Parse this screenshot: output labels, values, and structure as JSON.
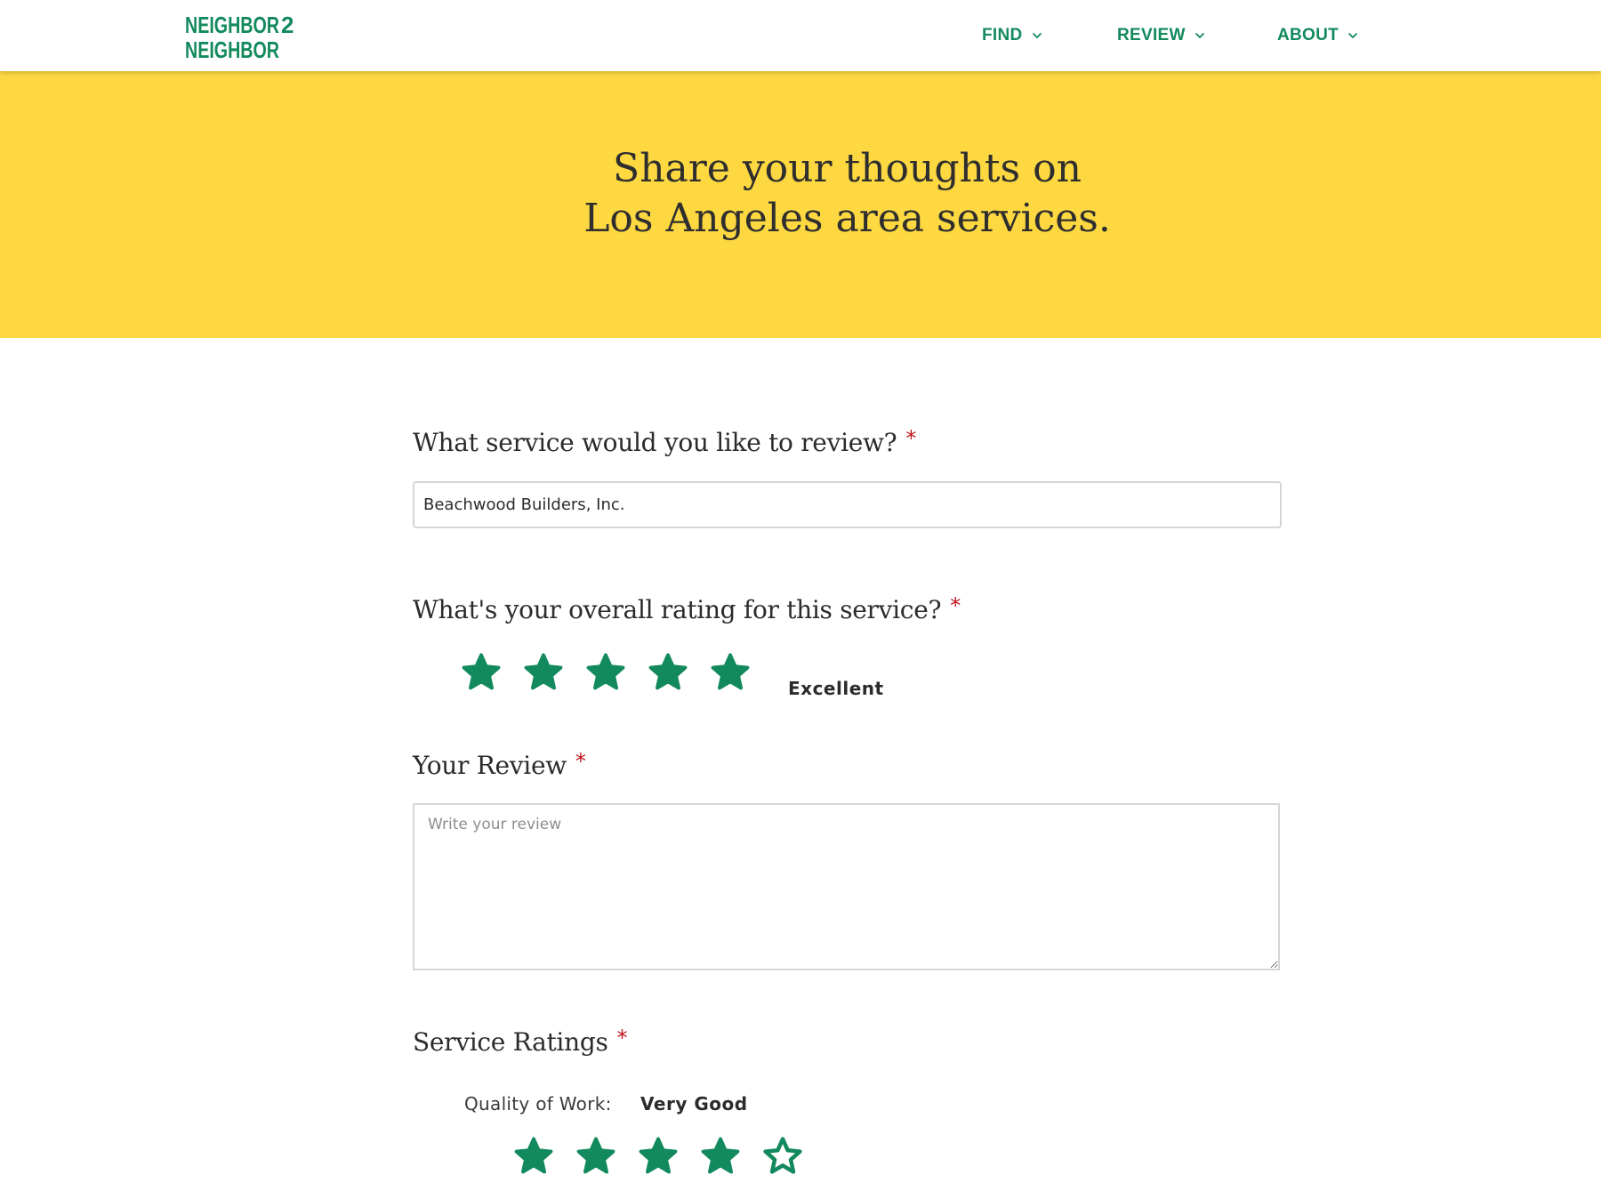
{
  "header": {
    "logo_text": "NEIGHBOR2NEIGHBOR",
    "nav": [
      {
        "label": "FIND"
      },
      {
        "label": "REVIEW"
      },
      {
        "label": "ABOUT"
      }
    ]
  },
  "hero": {
    "line1": "Share your thoughts on",
    "line2": "Los Angeles area services."
  },
  "form": {
    "service_question": "What service would you like to review?",
    "service_value": "Beachwood Builders, Inc.",
    "overall_question": "What's your overall rating for this service?",
    "overall_rating": 5,
    "overall_rating_max": 5,
    "overall_rating_text": "Excellent",
    "review_label": "Your Review",
    "review_placeholder": "Write your review",
    "review_value": "",
    "service_ratings_label": "Service Ratings",
    "quality_label": "Quality of Work:",
    "quality_rating": 4,
    "quality_rating_max": 5,
    "quality_rating_text": "Very Good",
    "required_mark": "*"
  },
  "colors": {
    "brand_green": "#138a5e",
    "hero_yellow": "#fdd841",
    "required_red": "#c0141e"
  },
  "icons": {
    "star_filled": "star-filled-icon",
    "star_empty": "star-outline-icon",
    "nav_chevron": "chevron-down-icon"
  }
}
